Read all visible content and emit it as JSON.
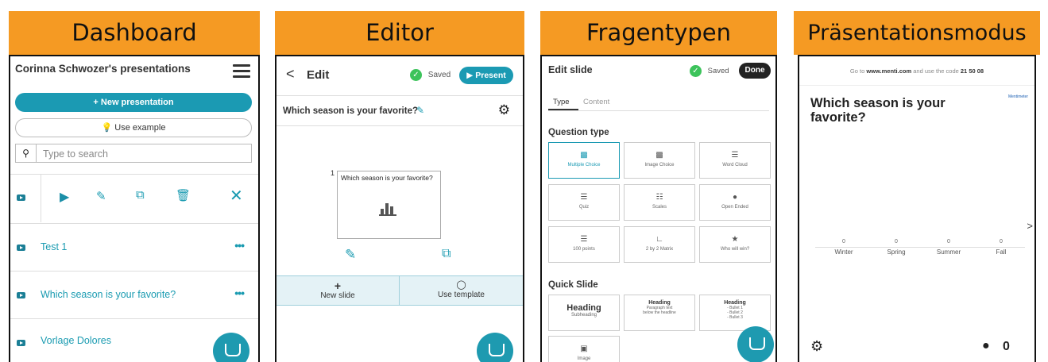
{
  "headers": [
    "Dashboard",
    "Editor",
    "Fragentypen",
    "Präsentationsmodus"
  ],
  "dashboard": {
    "title": "Corinna Schwozer's presentations",
    "new_presentation": "+ New presentation",
    "use_example": "💡 Use example",
    "search_placeholder": "Type to search",
    "presentations": [
      "Test 1",
      "Which season is your favorite?",
      "Vorlage Dolores"
    ],
    "more": "•••"
  },
  "editor": {
    "back": "<",
    "title": "Edit",
    "saved": "Saved",
    "present": "▶ Present",
    "slide_title": "Which season is your favorite?",
    "slide_number": "1",
    "thumb_text": "Which season is your favorite?",
    "new_slide": "New slide",
    "use_template": "Use template"
  },
  "types": {
    "title": "Edit slide",
    "saved": "Saved",
    "done": "Done",
    "tabs": [
      "Type",
      "Content"
    ],
    "question_type_heading": "Question type",
    "question_types": [
      "Multiple Choice",
      "Image Choice",
      "Word Cloud",
      "Quiz",
      "Scales",
      "Open Ended",
      "100 points",
      "2 by 2 Matrix",
      "Who will win?"
    ],
    "quick_slide_heading": "Quick Slide",
    "quick_slides": [
      {
        "title": "Heading",
        "sub": "Subheading"
      },
      {
        "title": "Heading",
        "sub": "Paragraph text below the headline"
      },
      {
        "title": "Heading",
        "sub": "- Bullet 1\n- Bullet 2\n- Bullet 3"
      }
    ],
    "image_label": "Image"
  },
  "presentation": {
    "instruction_prefix": "Go to",
    "instruction_url": "www.menti.com",
    "instruction_mid": "and use the code",
    "code": "21 50 08",
    "brand": "Mentimeter",
    "question": "Which season is your favorite?",
    "chart_data": {
      "type": "bar",
      "categories": [
        "Winter",
        "Spring",
        "Summer",
        "Fall"
      ],
      "values": [
        0,
        0,
        0,
        0
      ]
    },
    "next": ">",
    "audience_count": "0"
  },
  "colors": {
    "header": "#f59a23",
    "accent": "#1b9ab3",
    "saved": "#3cc35b"
  }
}
